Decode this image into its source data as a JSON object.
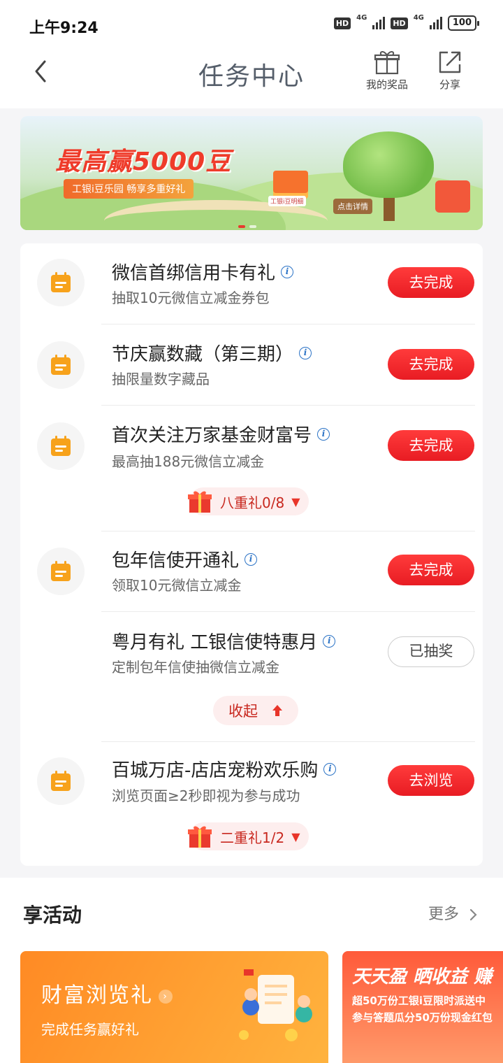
{
  "status_bar": {
    "time": "上午9:24",
    "hd": "HD",
    "network": "4G",
    "battery": "100"
  },
  "header": {
    "title": "任务中心",
    "prizes_label": "我的奖品",
    "share_label": "分享"
  },
  "banner": {
    "headline": "最高赢5000豆",
    "subtitle": "工银i豆乐园 畅享多重好礼",
    "box_label": "工银i豆明细",
    "sign_label": "点击详情"
  },
  "tasks": [
    {
      "title": "微信首绑信用卡有礼",
      "desc": "抽取10元微信立减金券包",
      "button": "去完成"
    },
    {
      "title": "节庆赢数藏（第三期）",
      "desc": "抽限量数字藏品",
      "button": "去完成"
    },
    {
      "title": "首次关注万家基金财富号",
      "desc": "最高抽188元微信立减金",
      "button": "去完成",
      "gift": "八重礼0/8"
    },
    {
      "title": "包年信使开通礼",
      "desc": "领取10元微信立减金",
      "button": "去完成"
    },
    {
      "title": "粤月有礼 工银信使特惠月",
      "desc": "定制包年信使抽微信立减金",
      "button": "已抽奖",
      "collapse": "收起"
    },
    {
      "title": "百城万店-店店宠粉欢乐购",
      "desc": "浏览页面≥2秒即视为参与成功",
      "button": "去浏览",
      "gift": "二重礼1/2"
    }
  ],
  "activities": {
    "title": "享活动",
    "more": "更多",
    "cards": [
      {
        "title": "财富浏览礼",
        "subtitle": "完成任务赢好礼"
      },
      {
        "title": "天天盈 晒收益 赚",
        "line1": "超50万份工银i豆限时派送中",
        "line2": "参与答题瓜分50万份现金红包"
      }
    ]
  },
  "colors": {
    "accent": "#e81c23",
    "task_icon": "#f7a21b",
    "info": "#2b73c6"
  }
}
